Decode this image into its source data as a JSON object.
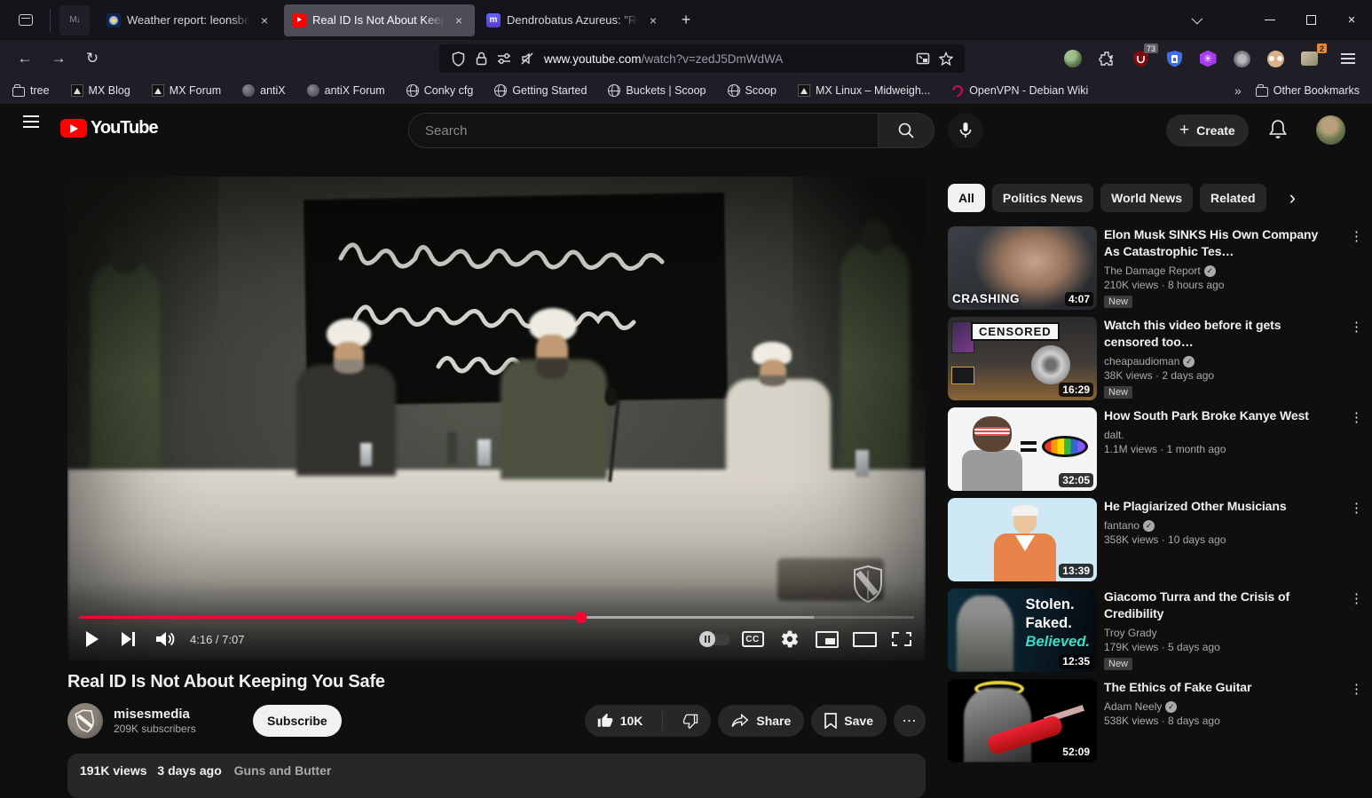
{
  "icons": {
    "close": "×",
    "plus": "+",
    "kebab": "⋮",
    "more_horizontal": "⋯",
    "chevron_right": "›",
    "overflow": "»",
    "check": "✓",
    "back": "←",
    "forward": "→",
    "reload": "↻"
  },
  "browser": {
    "pinned_tab": "M↓",
    "tabs": [
      {
        "title": "Weather report: leonsber"
      },
      {
        "title": "Real ID Is Not About Keep"
      },
      {
        "title": "Dendrobatus Azureus: \"Re"
      }
    ],
    "url_host": "www.youtube.com",
    "url_path": "/watch?v=zedJ5DmWdWA",
    "ublock_badge": "73",
    "extension_badge": "2",
    "bookmarks": [
      "tree",
      "MX Blog",
      "MX Forum",
      "antiX",
      "antiX Forum",
      "Conky cfg",
      "Getting Started",
      "Buckets | Scoop",
      "Scoop",
      "MX Linux – Midweigh...",
      "OpenVPN - Debian Wiki"
    ],
    "other_bookmarks_label": "Other Bookmarks"
  },
  "yt_header": {
    "logo_text": "YouTube",
    "search_placeholder": "Search",
    "create_label": "Create"
  },
  "player": {
    "time_display": "4:16 / 7:07",
    "progress_percent": 60,
    "buffered_percent": 88
  },
  "video": {
    "title": "Real ID Is Not About Keeping You Safe",
    "channel": "misesmedia",
    "subscribers": "209K subscribers",
    "subscribe_label": "Subscribe",
    "like_count": "10K",
    "share_label": "Share",
    "save_label": "Save",
    "views": "191K views",
    "uploaded": "3 days ago",
    "tag": "Guns and Butter"
  },
  "sidebar": {
    "chips": [
      "All",
      "Politics News",
      "World News",
      "Related"
    ],
    "videos": [
      {
        "title": "Elon Musk SINKS His Own Company As Catastrophic Tes…",
        "channel": "The Damage Report",
        "stats": "210K views · 8 hours ago",
        "duration": "4:07",
        "badge": "New",
        "overlay": "CRASHING"
      },
      {
        "title": "Watch this video before it gets censored too…",
        "channel": "cheapaudioman",
        "stats": "38K views · 2 days ago",
        "duration": "16:29",
        "badge": "New",
        "overlay": "CENSORED"
      },
      {
        "title": "How South Park Broke Kanye West",
        "channel": "dalt.",
        "stats": "1.1M views · 1 month ago",
        "duration": "32:05"
      },
      {
        "title": "He Plagiarized Other Musicians",
        "channel": "fantano",
        "stats": "358K views · 10 days ago",
        "duration": "13:39"
      },
      {
        "title": "Giacomo Turra and the Crisis of Credibility",
        "channel": "Troy Grady",
        "stats": "179K views · 5 days ago",
        "duration": "12:35",
        "badge": "New",
        "overlay_l1": "Stolen.",
        "overlay_l2": "Faked.",
        "overlay_l3": "Believed."
      },
      {
        "title": "The Ethics of Fake Guitar",
        "channel": "Adam Neely",
        "stats": "538K views · 8 days ago",
        "duration": "52:09"
      }
    ]
  }
}
